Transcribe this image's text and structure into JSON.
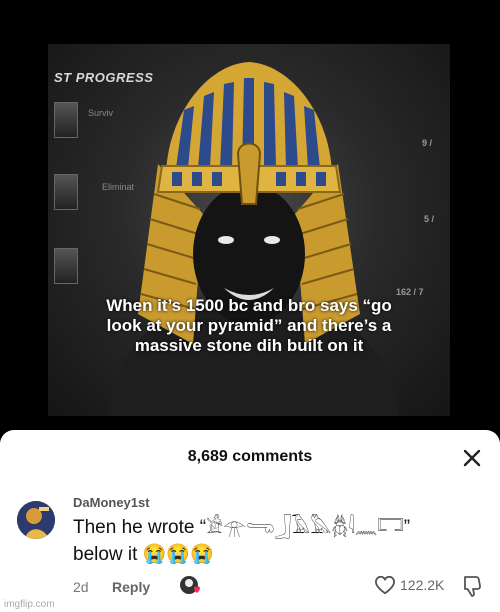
{
  "meme": {
    "progress_title": "ST PROGRESS",
    "rows": [
      {
        "label": "Surviv",
        "value": "9 /"
      },
      {
        "label": "Eliminat",
        "value": "5 /"
      },
      {
        "label": "",
        "value": "162 / 7"
      }
    ],
    "caption_lines": [
      "When it’s 1500 bc and bro says “go",
      "look at your pyramid” and there’s a",
      "massive stone dih built on it"
    ]
  },
  "sheet": {
    "comments_count": "8,689 comments",
    "close_icon": "close-icon"
  },
  "comment": {
    "username": "DaMoney1st",
    "text_line1": "Then he wrote “𓀀𓁿𓂸𓃀𓄿𓅓𓆣𓇋𓈖𓉐”",
    "text_line2": "below it 😭😭😭",
    "age": "2d",
    "reply_label": "Reply",
    "like_count": "122.2K",
    "liked_by_creator": true
  },
  "watermark": "imgflip.com",
  "colors": {
    "sheet_bg": "#ffffff",
    "gold": "#d4a634",
    "blue_stripe": "#2d4a8c"
  }
}
